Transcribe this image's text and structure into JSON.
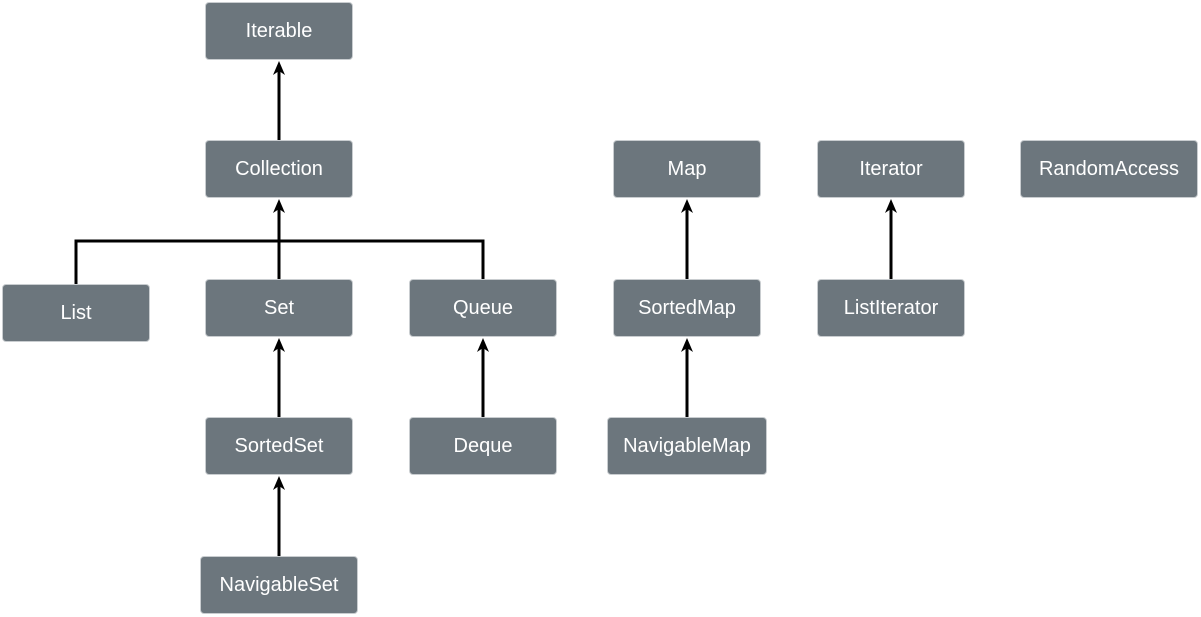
{
  "colors": {
    "node_fill": "#6c767d",
    "edge": "#000000",
    "text": "#ffffff"
  },
  "nodes": [
    {
      "id": "iterable",
      "label": "Iterable"
    },
    {
      "id": "collection",
      "label": "Collection"
    },
    {
      "id": "list",
      "label": "List"
    },
    {
      "id": "set",
      "label": "Set"
    },
    {
      "id": "queue",
      "label": "Queue"
    },
    {
      "id": "sortedset",
      "label": "SortedSet"
    },
    {
      "id": "deque",
      "label": "Deque"
    },
    {
      "id": "navigableset",
      "label": "NavigableSet"
    },
    {
      "id": "map",
      "label": "Map"
    },
    {
      "id": "sortedmap",
      "label": "SortedMap"
    },
    {
      "id": "navigablemap",
      "label": "NavigableMap"
    },
    {
      "id": "iterator",
      "label": "Iterator"
    },
    {
      "id": "listiterator",
      "label": "ListIterator"
    },
    {
      "id": "randomaccess",
      "label": "RandomAccess"
    }
  ],
  "edges": [
    {
      "from": "collection",
      "to": "iterable"
    },
    {
      "from": "list",
      "to": "collection"
    },
    {
      "from": "set",
      "to": "collection"
    },
    {
      "from": "queue",
      "to": "collection"
    },
    {
      "from": "sortedset",
      "to": "set"
    },
    {
      "from": "navigableset",
      "to": "sortedset"
    },
    {
      "from": "deque",
      "to": "queue"
    },
    {
      "from": "sortedmap",
      "to": "map"
    },
    {
      "from": "navigablemap",
      "to": "sortedmap"
    },
    {
      "from": "listiterator",
      "to": "iterator"
    }
  ]
}
